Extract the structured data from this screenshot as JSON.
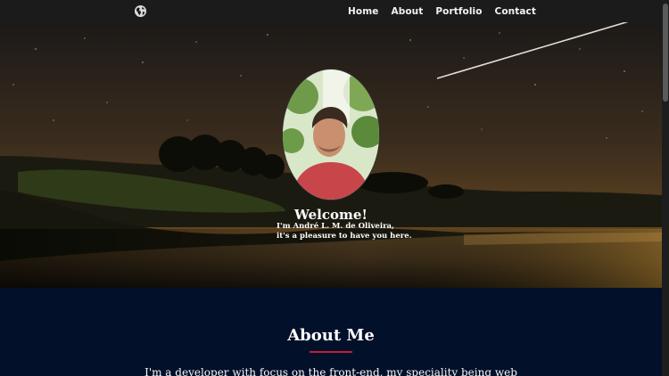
{
  "nav": {
    "logo_icon": "globe-icon",
    "links": [
      {
        "label": "Home"
      },
      {
        "label": "About"
      },
      {
        "label": "Portfolio"
      },
      {
        "label": "Contact"
      }
    ]
  },
  "hero": {
    "welcome_title": "Welcome!",
    "welcome_line1": "I'm André L. M. de Oliveira,",
    "welcome_line2": "it's a pleasure to have you here."
  },
  "about": {
    "title": "About Me",
    "text": "I'm a developer with focus on the front-end, my speciality being web"
  },
  "colors": {
    "navbar": "#1b1b1b",
    "about_bg": "#03102a",
    "accent": "#c0223a"
  }
}
